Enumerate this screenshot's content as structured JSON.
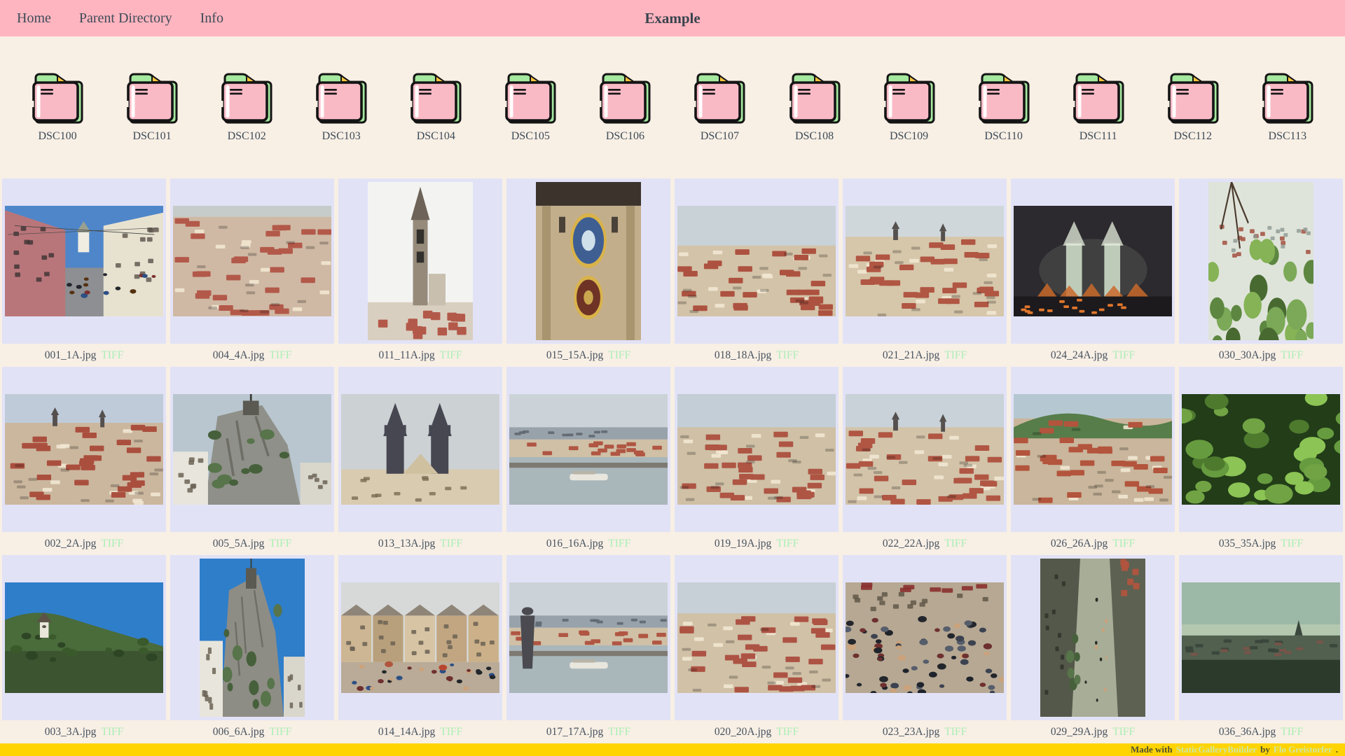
{
  "theme": {
    "header_pink": "#ffb5c0",
    "page_cream": "#f8efe5",
    "cell_lavender": "#e2e2f7",
    "footer_gold": "#ffd400",
    "text_ink": "#3d4b57",
    "tag_mint": "#a9efb4",
    "folder_pink": "#f9bac6",
    "folder_green": "#a5e89f",
    "folder_accent": "#ffc43d",
    "footer_link_green": "#cee7a7"
  },
  "header": {
    "nav": [
      {
        "label": "Home"
      },
      {
        "label": "Parent Directory"
      },
      {
        "label": "Info"
      }
    ],
    "title": "Example"
  },
  "folders": [
    "DSC100",
    "DSC101",
    "DSC102",
    "DSC103",
    "DSC104",
    "DSC105",
    "DSC106",
    "DSC107",
    "DSC108",
    "DSC109",
    "DSC110",
    "DSC111",
    "DSC112",
    "DSC113"
  ],
  "gallery": {
    "rows": [
      [
        {
          "file": "001_1A.jpg",
          "tag": "TIFF",
          "kind": "street",
          "orient": "l",
          "sky": "#4f86c9",
          "main": "#b9767a",
          "accent": "#e7e2d0"
        },
        {
          "file": "004_4A.jpg",
          "tag": "TIFF",
          "kind": "panorama",
          "orient": "l",
          "sky": "#c6ccc9",
          "skyH": 10,
          "main": "#cfb9a4",
          "accent": "#b3594a"
        },
        {
          "file": "011_11A.jpg",
          "tag": "TIFF",
          "kind": "tower",
          "orient": "p",
          "sky": "#f3f4f2",
          "main": "#968a7a",
          "accent": "#b3594a"
        },
        {
          "file": "015_15A.jpg",
          "tag": "TIFF",
          "kind": "clock",
          "orient": "p",
          "sky": "#a8946f",
          "main": "#c3ae8c",
          "accent": "#3f5f93"
        },
        {
          "file": "018_18A.jpg",
          "tag": "TIFF",
          "kind": "panorama",
          "orient": "l",
          "sky": "#c9d2d6",
          "skyH": 36,
          "main": "#d3c3a8",
          "accent": "#ad5240"
        },
        {
          "file": "021_21A.jpg",
          "tag": "TIFF",
          "kind": "panorama",
          "orient": "l",
          "sky": "#cfd7db",
          "skyH": 28,
          "main": "#d6c6aa",
          "accent": "#b05643",
          "towers": true
        },
        {
          "file": "024_24A.jpg",
          "tag": "TIFF",
          "kind": "night",
          "orient": "l",
          "sky": "#2c2a2e",
          "main": "#d6e4cf",
          "accent": "#e0762c"
        },
        {
          "file": "030_30A.jpg",
          "tag": "TIFF",
          "kind": "treescity",
          "orient": "p",
          "sky": "#dfe4da",
          "main": "#5d8741",
          "accent": "#a65848"
        }
      ],
      [
        {
          "file": "002_2A.jpg",
          "tag": "TIFF",
          "kind": "panorama",
          "orient": "l",
          "sky": "#bfcbd8",
          "skyH": 26,
          "main": "#cbb79e",
          "accent": "#aa4f3e",
          "towers": true
        },
        {
          "file": "005_5A.jpg",
          "tag": "TIFF",
          "kind": "cliff",
          "orient": "l",
          "sky": "#b9c6cf",
          "main": "#8f9089",
          "accent": "#e8e5dc"
        },
        {
          "file": "013_13A.jpg",
          "tag": "TIFF",
          "kind": "twin",
          "orient": "l",
          "sky": "#ccd1d4",
          "main": "#474752",
          "accent": "#d8cbb0"
        },
        {
          "file": "016_16A.jpg",
          "tag": "TIFF",
          "kind": "river",
          "orient": "l",
          "sky": "#ccd3d8",
          "main": "#a9b6ba",
          "accent": "#b05643"
        },
        {
          "file": "019_19A.jpg",
          "tag": "TIFF",
          "kind": "panorama",
          "orient": "l",
          "sky": "#c3ced6",
          "skyH": 30,
          "main": "#cfc0a6",
          "accent": "#ae5544"
        },
        {
          "file": "022_22A.jpg",
          "tag": "TIFF",
          "kind": "panorama",
          "orient": "l",
          "sky": "#c8d2d8",
          "skyH": 30,
          "main": "#d2c3a9",
          "accent": "#b05643",
          "towers": true
        },
        {
          "file": "026_26A.jpg",
          "tag": "TIFF",
          "kind": "panorama",
          "orient": "l",
          "sky": "#b5c8d2",
          "skyH": 22,
          "main": "#c9b69c",
          "accent": "#b3543d",
          "hill": "#577d4a"
        },
        {
          "file": "035_35A.jpg",
          "tag": "TIFF",
          "kind": "foliage",
          "orient": "l",
          "sky": "#223d18",
          "main": "#679b3f",
          "accent": "#8cc455"
        }
      ],
      [
        {
          "file": "003_3A.jpg",
          "tag": "TIFF",
          "kind": "hill",
          "orient": "l",
          "sky": "#2f7ec9",
          "main": "#4a6b3a",
          "accent": "#e9e6da"
        },
        {
          "file": "006_6A.jpg",
          "tag": "TIFF",
          "kind": "cliff",
          "orient": "p",
          "sky": "#2f7ec9",
          "main": "#8e8d85",
          "accent": "#e8e5dc"
        },
        {
          "file": "014_14A.jpg",
          "tag": "TIFF",
          "kind": "square",
          "orient": "l",
          "sky": "#d6d9d8",
          "main": "#cdb693",
          "accent": "#b0543e"
        },
        {
          "file": "017_17A.jpg",
          "tag": "TIFF",
          "kind": "river",
          "orient": "l",
          "sky": "#ccd3d8",
          "main": "#a9b6ba",
          "accent": "#b05643",
          "statue": true
        },
        {
          "file": "020_20A.jpg",
          "tag": "TIFF",
          "kind": "panorama",
          "orient": "l",
          "sky": "#c6d0d6",
          "skyH": 28,
          "main": "#d0c1a7",
          "accent": "#ad5344"
        },
        {
          "file": "023_23A.jpg",
          "tag": "TIFF",
          "kind": "crowd",
          "orient": "l",
          "sky": "#b6a893",
          "main": "#3a3f4a",
          "accent": "#8a2f2f"
        },
        {
          "file": "029_29A.jpg",
          "tag": "TIFF",
          "kind": "aerial",
          "orient": "p",
          "sky": "#54584a",
          "main": "#a7ad97",
          "accent": "#b0543e"
        },
        {
          "file": "036_36A.jpg",
          "tag": "TIFF",
          "kind": "dusk",
          "orient": "l",
          "sky": "#9cb8a6",
          "main": "#51604f",
          "accent": "#7c5348"
        }
      ]
    ]
  },
  "footer": {
    "prefix": "Made with",
    "tool": "StaticGalleryBuilder",
    "middle": "by",
    "author": "Flo Greistorfer",
    "suffix": "."
  }
}
